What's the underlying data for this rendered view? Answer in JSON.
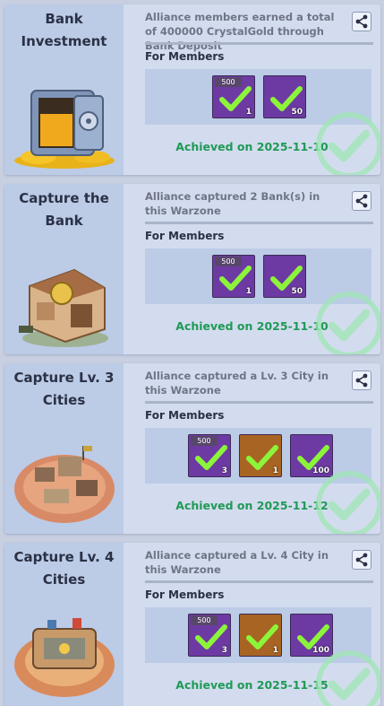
{
  "colors": {
    "achieved_text": "#1f9a55",
    "check_green": "#8cf53a",
    "purple_item": "#6d3aa3",
    "orange_item": "#a86422"
  },
  "cards": [
    {
      "title": "Bank\nInvestment",
      "description": "Alliance members earned a total of 400000 CrystalGold through Bank Deposit",
      "section_label": "For Members",
      "rewards": [
        {
          "icon": "crystal-gold-icon",
          "color": "purple",
          "tag": "500",
          "qty": "1"
        },
        {
          "icon": "red-gem-icon",
          "color": "purple",
          "tag": "",
          "qty": "50"
        }
      ],
      "achieved": "Achieved on 2025-11-10"
    },
    {
      "title": "Capture the\nBank",
      "description": "Alliance captured 2 Bank(s) in this Warzone",
      "section_label": "For Members",
      "rewards": [
        {
          "icon": "crystal-gold-icon",
          "color": "purple",
          "tag": "500",
          "qty": "1"
        },
        {
          "icon": "red-gem-icon",
          "color": "purple",
          "tag": "",
          "qty": "50"
        }
      ],
      "achieved": "Achieved on 2025-11-10"
    },
    {
      "title": "Capture Lv. 3\nCities",
      "description": "Alliance captured a Lv. 3 City in this Warzone",
      "section_label": "For Members",
      "rewards": [
        {
          "icon": "crystal-gold-icon",
          "color": "purple",
          "tag": "500",
          "qty": "3"
        },
        {
          "icon": "gold-bar-icon",
          "color": "orange",
          "tag": "",
          "qty": "1"
        },
        {
          "icon": "red-gem-icon",
          "color": "purple",
          "tag": "",
          "qty": "100"
        }
      ],
      "achieved": "Achieved on 2025-11-12"
    },
    {
      "title": "Capture Lv. 4\nCities",
      "description": "Alliance captured a Lv. 4 City in this Warzone",
      "section_label": "For Members",
      "rewards": [
        {
          "icon": "crystal-gold-icon",
          "color": "purple",
          "tag": "500",
          "qty": "3"
        },
        {
          "icon": "gold-bar-icon",
          "color": "orange",
          "tag": "",
          "qty": "1"
        },
        {
          "icon": "red-gem-icon",
          "color": "purple",
          "tag": "",
          "qty": "100"
        }
      ],
      "achieved": "Achieved on 2025-11-15"
    }
  ]
}
